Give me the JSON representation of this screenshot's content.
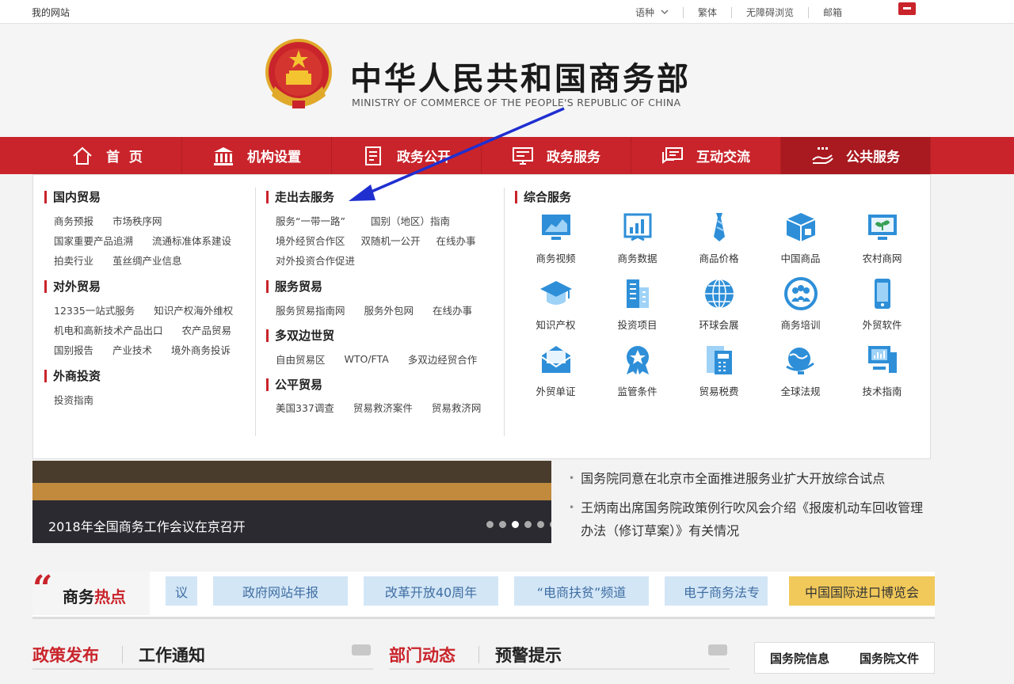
{
  "topbar": {
    "site": "我的网站",
    "language": "语种",
    "traditional": "繁体",
    "accessible": "无障碍浏览",
    "mail": "邮箱"
  },
  "header": {
    "title_cn": "中华人民共和国商务部",
    "title_en": "MINISTRY OF COMMERCE OF THE PEOPLE'S REPUBLIC OF CHINA"
  },
  "nav": {
    "items": [
      {
        "label": "首  页",
        "icon": "home-icon"
      },
      {
        "label": "机构设置",
        "icon": "building-icon"
      },
      {
        "label": "政务公开",
        "icon": "document-icon"
      },
      {
        "label": "政务服务",
        "icon": "monitor-icon"
      },
      {
        "label": "互动交流",
        "icon": "chat-icon"
      },
      {
        "label": "公共服务",
        "icon": "hand-icon"
      }
    ]
  },
  "dropdown": {
    "col1": {
      "sections": [
        {
          "title": "国内贸易",
          "rows": [
            [
              "商务预报",
              "市场秩序网"
            ],
            [
              "国家重要产品追溯",
              "流通标准体系建设"
            ],
            [
              "拍卖行业",
              "茧丝绸产业信息"
            ]
          ]
        },
        {
          "title": "对外贸易",
          "rows": [
            [
              "12335一站式服务",
              "知识产权海外维权"
            ],
            [
              "机电和高新技术产品出口",
              "农产品贸易"
            ],
            [
              "国别报告",
              "产业技术",
              "境外商务投诉"
            ]
          ]
        },
        {
          "title": "外商投资",
          "rows": [
            [
              "投资指南"
            ]
          ]
        }
      ]
    },
    "col2": {
      "sections": [
        {
          "title": "走出去服务",
          "rows": [
            [
              "服务“一带一路”",
              "国别（地区）指南"
            ],
            [
              "境外经贸合作区",
              "双随机一公开",
              "在线办事"
            ],
            [
              "对外投资合作促进"
            ]
          ]
        },
        {
          "title": "服务贸易",
          "rows": [
            [
              "服务贸易指南网",
              "服务外包网",
              "在线办事"
            ]
          ]
        },
        {
          "title": "多双边世贸",
          "rows": [
            [
              "自由贸易区",
              "WTO/FTA",
              "多双边经贸合作"
            ]
          ]
        },
        {
          "title": "公平贸易",
          "rows": [
            [
              "美国337调查",
              "贸易救济案件",
              "贸易救济网"
            ]
          ]
        }
      ]
    },
    "col3": {
      "title": "综合服务",
      "services": [
        {
          "label": "商务视频",
          "icon": "video-chart-icon"
        },
        {
          "label": "商务数据",
          "icon": "data-chart-icon"
        },
        {
          "label": "商品价格",
          "icon": "tie-icon"
        },
        {
          "label": "中国商品",
          "icon": "box-icon"
        },
        {
          "label": "农村商网",
          "icon": "plant-monitor-icon"
        },
        {
          "label": "知识产权",
          "icon": "graduation-cap-icon"
        },
        {
          "label": "投资项目",
          "icon": "building-icon"
        },
        {
          "label": "环球会展",
          "icon": "globe-icon"
        },
        {
          "label": "商务培训",
          "icon": "people-icon"
        },
        {
          "label": "外贸软件",
          "icon": "phone-icon"
        },
        {
          "label": "外贸单证",
          "icon": "envelope-icon"
        },
        {
          "label": "监管条件",
          "icon": "badge-icon"
        },
        {
          "label": "贸易税费",
          "icon": "calculator-icon"
        },
        {
          "label": "全球法规",
          "icon": "globe-pin-icon"
        },
        {
          "label": "技术指南",
          "icon": "computer-icon"
        }
      ]
    }
  },
  "banner": {
    "caption": "2018年全国商务工作会议在京召开",
    "dots": 6,
    "active_dot": 3
  },
  "news": [
    "国务院同意在北京市全面推进服务业扩大开放综合试点",
    "王炳南出席国务院政策例行吹风会介绍《报废机动车回收管理办法（修订草案）》有关情况"
  ],
  "hot": {
    "title_a": "商务",
    "title_b": "热点",
    "pills": [
      "议",
      "政府网站年报",
      "改革开放40周年",
      "“电商扶贫”频道",
      "电子商务法专",
      "中国国际进口博览会"
    ]
  },
  "tabs": {
    "left_a": "政策发布",
    "left_b": "工作通知",
    "mid_a": "部门动态",
    "mid_b": "预警提示",
    "right_a": "国务院信息",
    "right_b": "国务院文件"
  },
  "colors": {
    "brand_red": "#c9242b",
    "pill_blue": "#d3e6f6",
    "pill_gold": "#f1c95a"
  }
}
